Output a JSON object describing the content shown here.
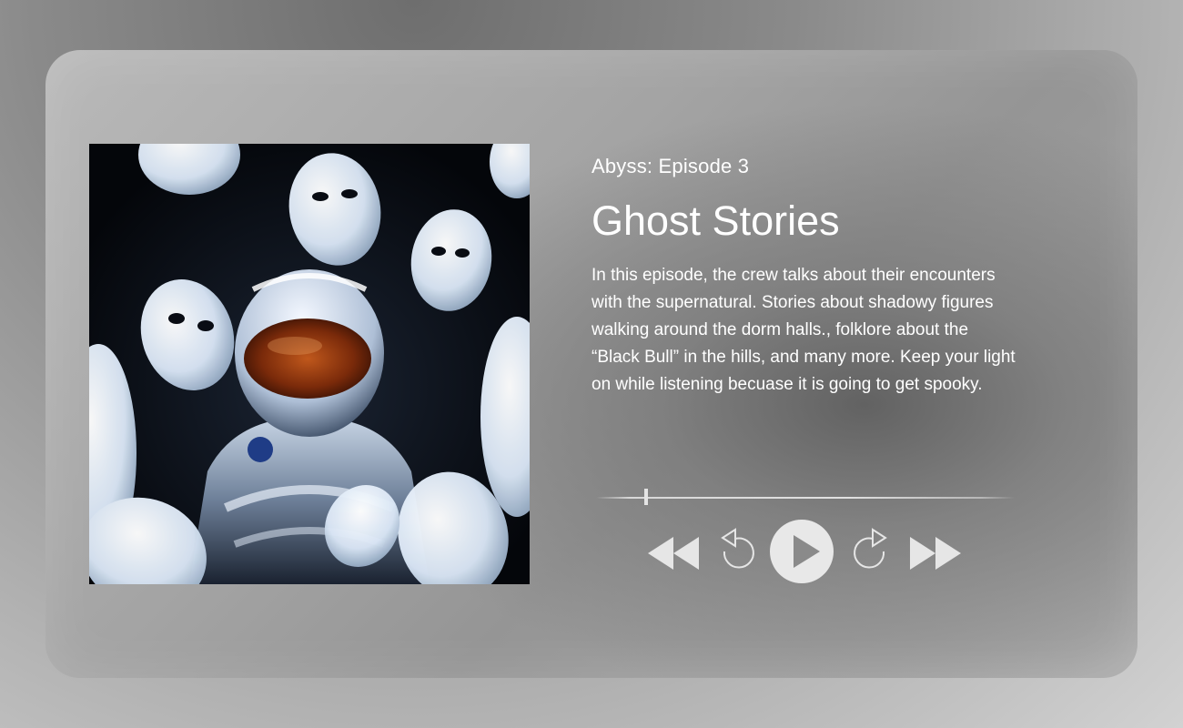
{
  "episode": {
    "series_label": "Abyss: Episode 3",
    "title": "Ghost Stories",
    "description": "In this episode, the crew talks about their encounters with the supernatural. Stories about shadowy figures walking around the dorm halls., folklore about the “Black Bull” in the hills, and many more. Keep your light on while listening becuase it is going to get spooky."
  },
  "player": {
    "progress_fraction": 0.12,
    "controls": {
      "rewind_icon": "rewind-icon",
      "replay_icon": "replay-icon",
      "play_icon": "play-icon",
      "forward_skip_icon": "skip-forward-icon",
      "fast_forward_icon": "fast-forward-icon"
    }
  },
  "colors": {
    "text": "#ffffff",
    "controls": "#e6e6e6"
  },
  "cover_art": {
    "icon": "astronaut-with-masks-artwork"
  }
}
